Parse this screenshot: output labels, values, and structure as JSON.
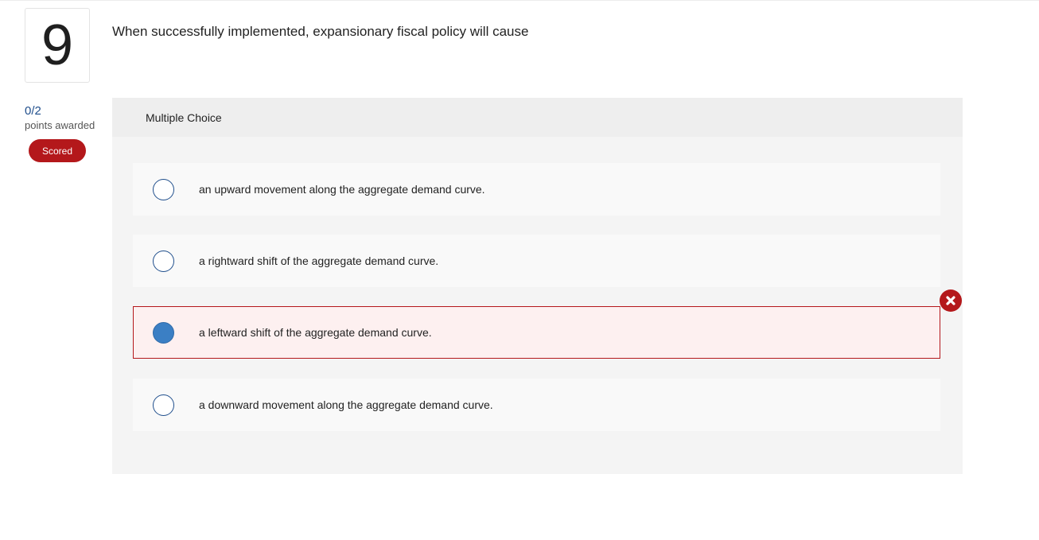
{
  "question": {
    "number": "9",
    "text": "When successfully implemented, expansionary fiscal policy will cause"
  },
  "score": {
    "value": "0/2",
    "label": "points awarded",
    "badge": "Scored"
  },
  "panel": {
    "type_label": "Multiple Choice"
  },
  "choices": [
    {
      "text": "an upward movement along the aggregate demand curve.",
      "selected": false,
      "status": "none"
    },
    {
      "text": "a rightward shift of the aggregate demand curve.",
      "selected": false,
      "status": "none"
    },
    {
      "text": "a leftward shift of the aggregate demand curve.",
      "selected": true,
      "status": "incorrect"
    },
    {
      "text": "a downward movement along the aggregate demand curve.",
      "selected": false,
      "status": "none"
    }
  ],
  "colors": {
    "accent": "#1f4e8c",
    "error": "#b4181b",
    "selected_fill": "#3b7fc4"
  },
  "icons": {
    "incorrect": "x-mark-icon"
  }
}
